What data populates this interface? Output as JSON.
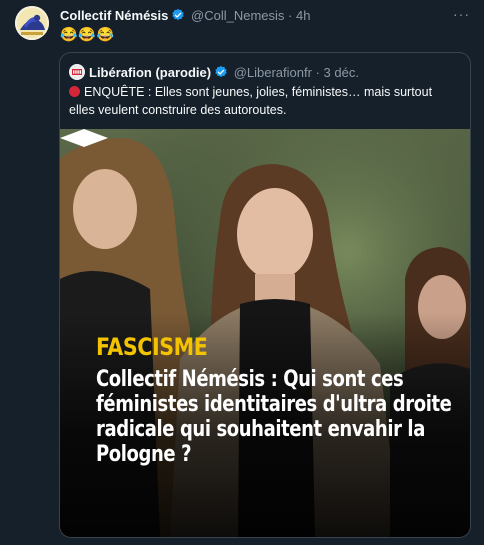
{
  "tweet": {
    "author_name": "Collectif Némésis",
    "author_handle": "@Coll_Nemesis",
    "separator": "·",
    "time": "4h",
    "more_label": "···",
    "text": "😂😂😂"
  },
  "quote": {
    "author_name": "Libérafion (parodie)",
    "author_handle": "@Liberafionfr",
    "separator": "·",
    "time": "3 déc.",
    "text": "ENQUÊTE : Elles sont jeunes, jolies, féministes… mais surtout elles veulent construire des autoroutes.",
    "media": {
      "kicker": "FASCISME",
      "headline": "Collectif Némésis : Qui sont ces féministes identitaires d'ultra droite radicale qui souhaitent envahir la Pologne ?"
    }
  },
  "colors": {
    "background": "#15202b",
    "border": "#38444d",
    "secondary_text": "#8b98a5",
    "verified": "#1d9bf0",
    "kicker": "#f3c300",
    "red_circle": "#d4263a"
  },
  "icons": {
    "verified": "verified-badge-icon",
    "more": "more-options-icon",
    "red_circle": "red-circle-icon",
    "logo": "liberation-logo-mark"
  }
}
